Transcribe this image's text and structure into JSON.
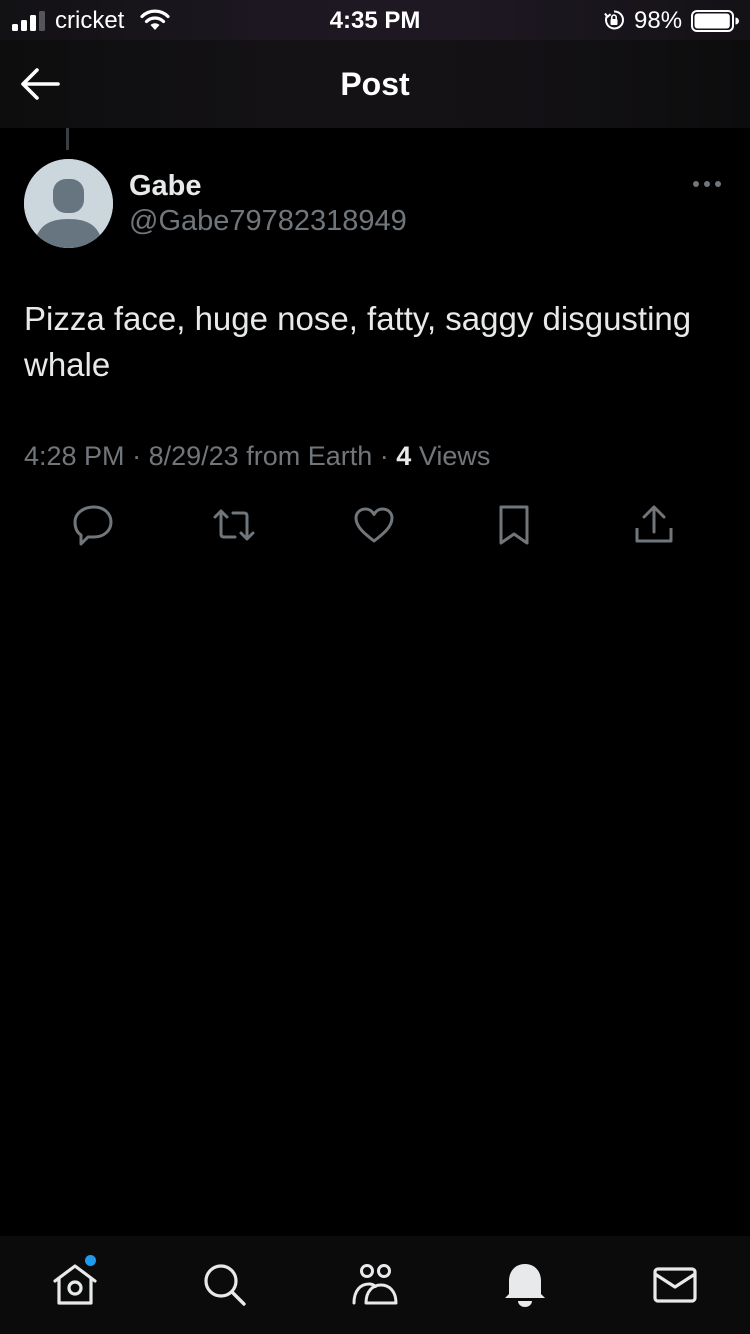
{
  "status_bar": {
    "carrier": "cricket",
    "time": "4:35 PM",
    "battery_percent": "98%",
    "battery_level": 0.98,
    "signal_bars": 3,
    "icons": [
      "signal-icon",
      "wifi-icon",
      "orientation-lock-icon",
      "battery-icon"
    ]
  },
  "header": {
    "title": "Post",
    "back_icon": "arrow-left-icon"
  },
  "post": {
    "author_name": "Gabe",
    "author_handle": "@Gabe79782318949",
    "text": "Pizza face, huge nose, fatty, saggy disgusting whale",
    "time": "4:28 PM",
    "date": "8/29/23",
    "source": "from Earth",
    "separator": "·",
    "views_count": "4",
    "views_label": "Views",
    "more_icon": "more-dots-icon",
    "actions": [
      "reply-icon",
      "retweet-icon",
      "like-icon",
      "bookmark-icon",
      "share-icon"
    ]
  },
  "tabbar": {
    "tabs": [
      "home-icon",
      "search-icon",
      "communities-icon",
      "notifications-icon",
      "messages-icon"
    ],
    "home_has_badge": true
  },
  "colors": {
    "background": "#000000",
    "primary_text": "#e7e9ea",
    "secondary_text": "#71767b",
    "accent": "#1d9bf0",
    "icon": "#71767b"
  }
}
